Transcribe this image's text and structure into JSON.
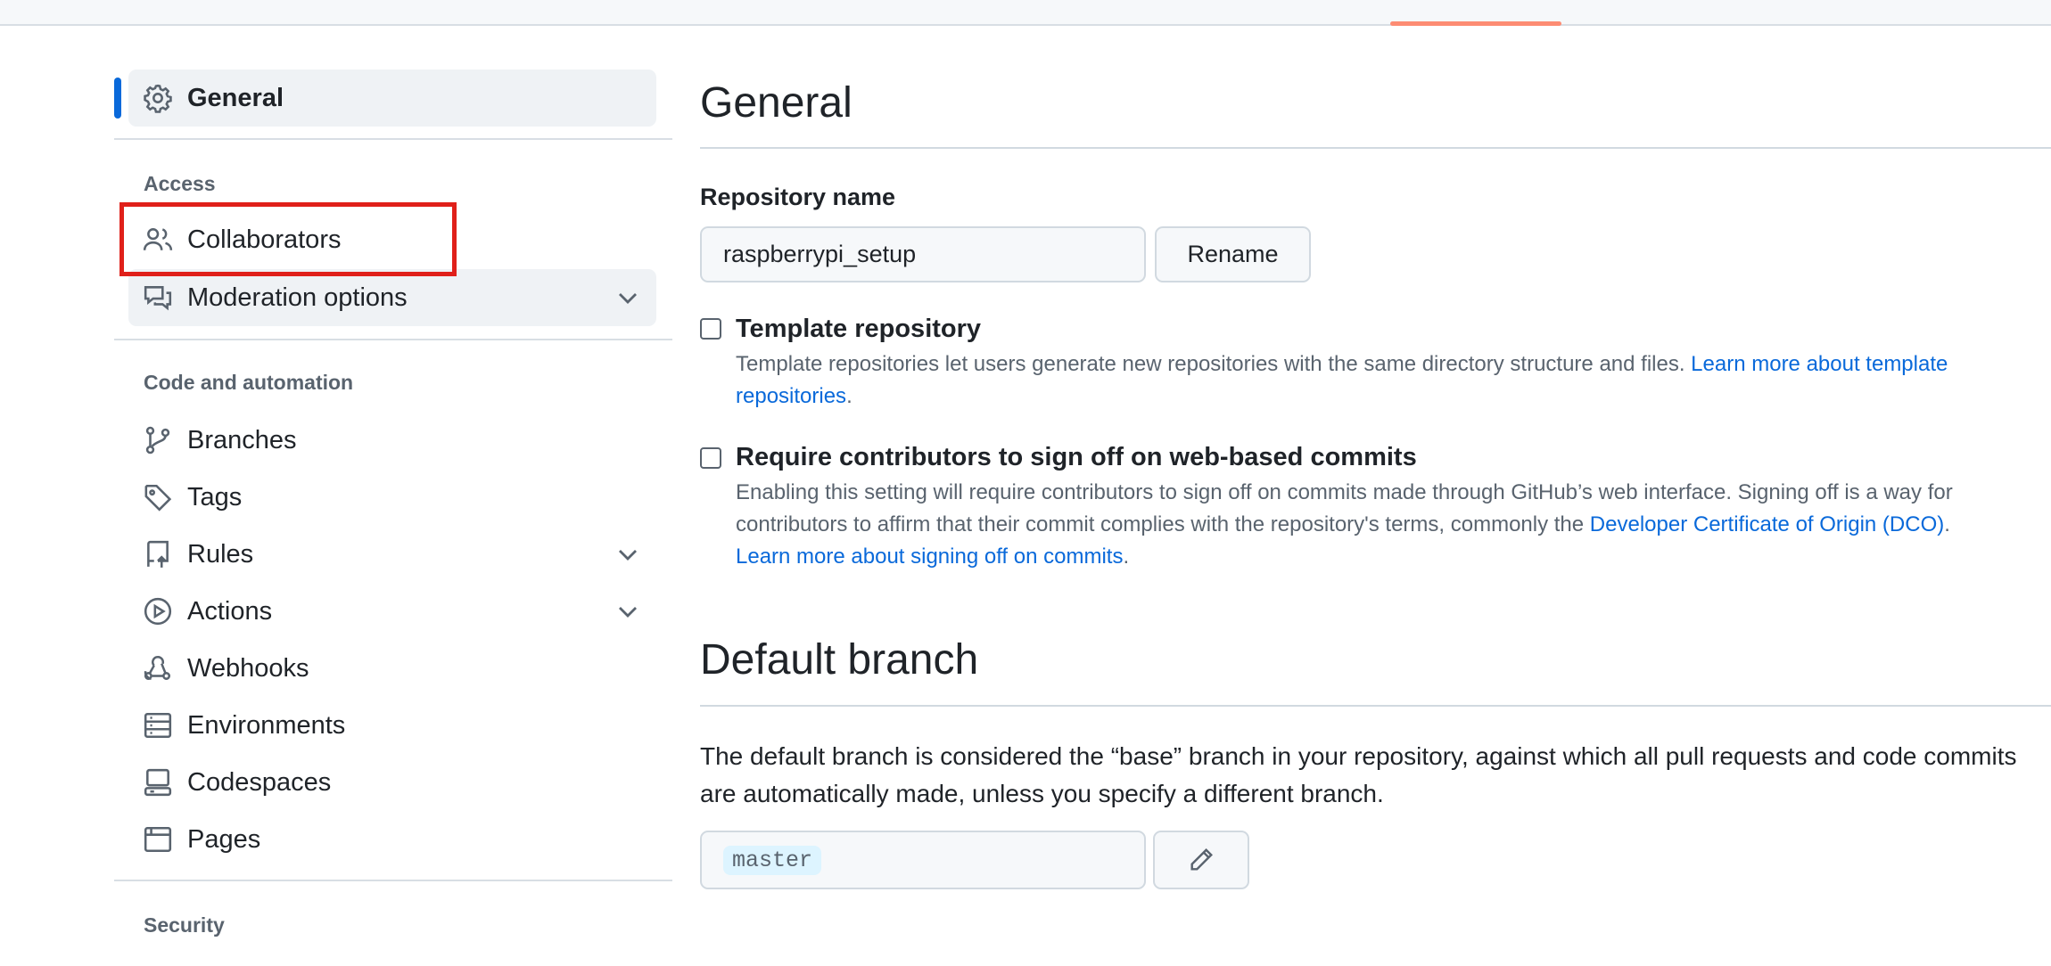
{
  "sidebar": {
    "general": "General",
    "access_heading": "Access",
    "collaborators": "Collaborators",
    "moderation": "Moderation options",
    "code_heading": "Code and automation",
    "branches": "Branches",
    "tags": "Tags",
    "rules": "Rules",
    "actions": "Actions",
    "webhooks": "Webhooks",
    "environments": "Environments",
    "codespaces": "Codespaces",
    "pages": "Pages",
    "security_heading": "Security"
  },
  "main": {
    "title": "General",
    "repo_name_label": "Repository name",
    "repo_name_value": "raspberrypi_setup",
    "rename_button": "Rename",
    "template": {
      "title": "Template repository",
      "desc": "Template repositories let users generate new repositories with the same directory structure and files. ",
      "link": "Learn more about template repositories",
      "trail": "."
    },
    "signoff": {
      "title": "Require contributors to sign off on web-based commits",
      "desc": "Enabling this setting will require contributors to sign off on commits made through GitHub’s web interface. Signing off is a way for contributors to affirm that their commit complies with the repository's terms, commonly the ",
      "dco_link": "Developer Certificate of Origin (DCO)",
      "mid": ".",
      "learn_link": "Learn more about signing off on commits",
      "trail": "."
    },
    "default_branch": {
      "title": "Default branch",
      "desc": "The default branch is considered the “base” branch in your repository, against which all pull requests and code commits are automatically made, unless you specify a different branch.",
      "branch": "master"
    }
  },
  "colors": {
    "accent": "#0969da",
    "underline": "#fd8c73",
    "highlight_box": "#e0201a"
  }
}
